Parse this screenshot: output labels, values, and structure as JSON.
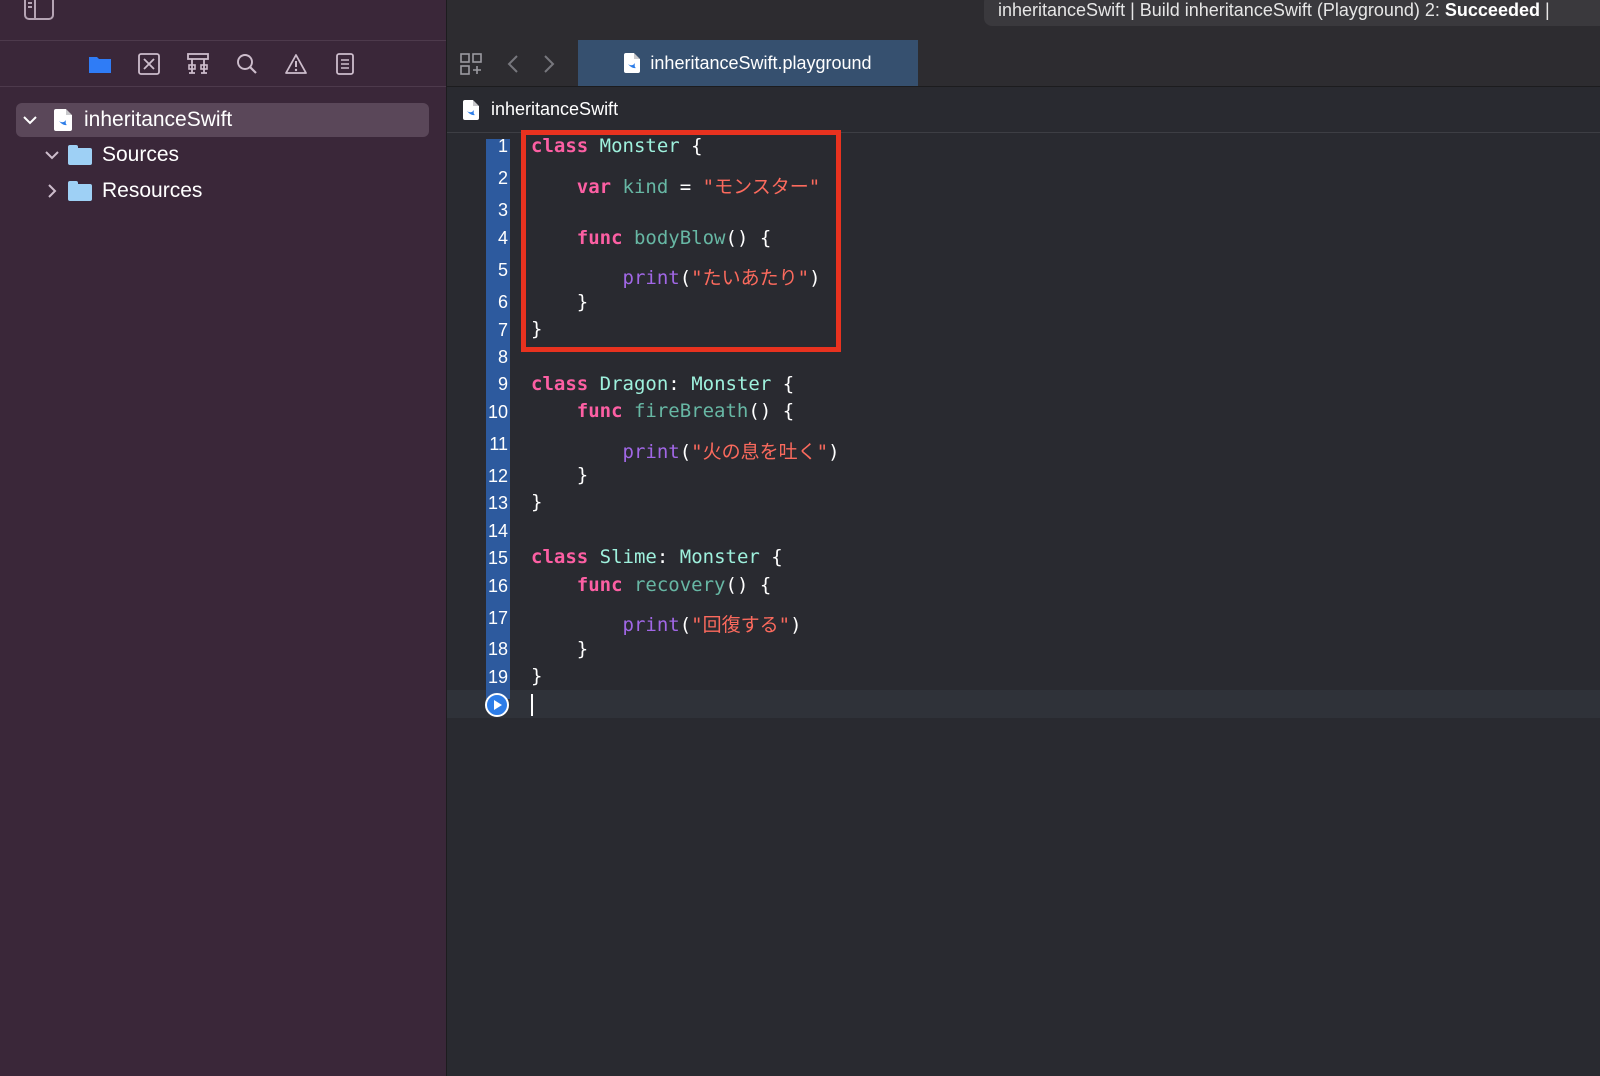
{
  "window": {
    "status_prefix": "inheritanceSwift | Build inheritanceSwift (Playground) 2: ",
    "status_result": "Succeeded",
    "status_suffix": " |"
  },
  "navigator": {
    "icons": [
      "folder-icon",
      "source-control-icon",
      "hierarchy-icon",
      "search-icon",
      "warning-icon",
      "report-icon"
    ],
    "tree": [
      {
        "label": "inheritanceSwift",
        "expanded": true,
        "icon": "swift-file-icon"
      },
      {
        "label": "Sources",
        "expanded": true,
        "icon": "folder-icon"
      },
      {
        "label": "Resources",
        "expanded": false,
        "icon": "folder-icon"
      }
    ]
  },
  "tabbar": {
    "tab_label": "inheritanceSwift.playground"
  },
  "jumpbar": {
    "label": "inheritanceSwift"
  },
  "editor": {
    "line_numbers": [
      "1",
      "2",
      "3",
      "4",
      "5",
      "6",
      "7",
      "8",
      "9",
      "10",
      "11",
      "12",
      "13",
      "14",
      "15",
      "16",
      "17",
      "18",
      "19"
    ],
    "code": {
      "l1": {
        "kw": "class",
        "type": "Monster",
        "rest": " {"
      },
      "l2": {
        "kw": "var",
        "name": "kind",
        "op": " = ",
        "str": "\"モンスター\""
      },
      "l4": {
        "kw": "func",
        "name": "bodyBlow",
        "rest": "() {"
      },
      "l5": {
        "fn": "print",
        "open": "(",
        "str": "\"たいあたり\"",
        "close": ")"
      },
      "l6": "}",
      "l7": "}",
      "l9": {
        "kw": "class",
        "type": "Dragon",
        "colon": ": ",
        "super": "Monster",
        "rest": " {"
      },
      "l10": {
        "kw": "func",
        "name": "fireBreath",
        "rest": "() {"
      },
      "l11": {
        "fn": "print",
        "open": "(",
        "str": "\"火の息を吐く\"",
        "close": ")"
      },
      "l12": "}",
      "l13": "}",
      "l15": {
        "kw": "class",
        "type": "Slime",
        "colon": ": ",
        "super": "Monster",
        "rest": " {"
      },
      "l16": {
        "kw": "func",
        "name": "recovery",
        "rest": "() {"
      },
      "l17": {
        "fn": "print",
        "open": "(",
        "str": "\"回復する\"",
        "close": ")"
      },
      "l18": "}",
      "l19": "}"
    }
  },
  "colors": {
    "sidebar_bg": "#3a2739",
    "editor_bg": "#292a30",
    "gutter_highlight": "#2d5a9e",
    "keyword": "#fc5fa3",
    "string": "#fc6a5d",
    "annotation_box": "#e8321f"
  }
}
